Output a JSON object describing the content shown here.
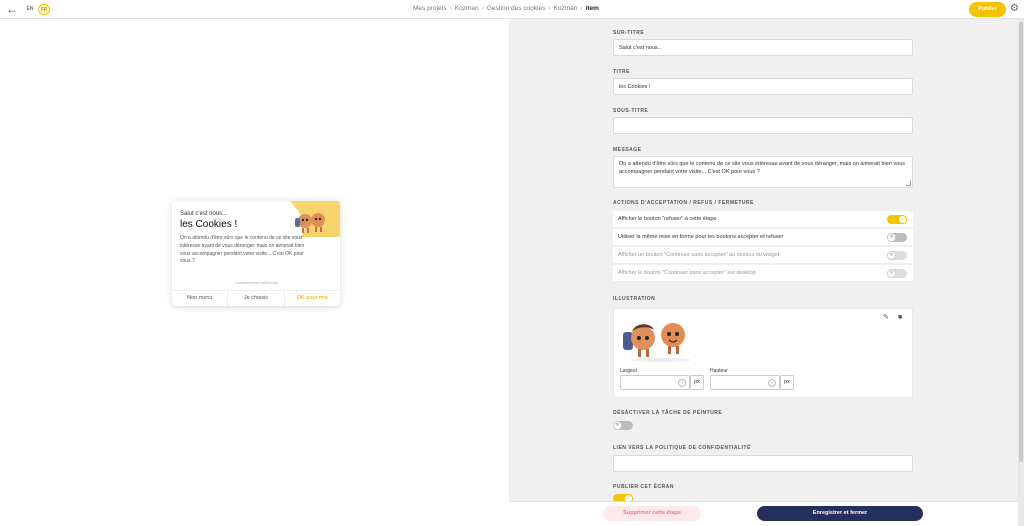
{
  "header": {
    "back_icon": "arrow-left-icon",
    "languages": [
      "EN",
      "FR"
    ],
    "breadcrumb": [
      "Mes projets",
      "Kozman",
      "Gestion des cookies",
      "Kozman",
      "item"
    ],
    "publish_label": "Publier",
    "settings_icon": "gear-icon",
    "accent_color": "#f5c400"
  },
  "preview": {
    "surtitle": "Salut c'est nous...",
    "title": "les Cookies !",
    "message": "On a attendu d'être sûrs que le contenu de ce site vous intéresse avant de vous déranger, mais on aimerait bien vous accompagner pendant votre visite... C'est OK pour vous ?",
    "certification": "Consentements certifiés par",
    "actions": [
      "Non merci",
      "Je choisis",
      "OK pour moi"
    ]
  },
  "form": {
    "surtitle": {
      "label": "SUR-TITRE",
      "value": "Salut c'est nous..."
    },
    "title": {
      "label": "TITRE",
      "value": "les Cookies !"
    },
    "subtitle": {
      "label": "SOUS-TITRE",
      "value": ""
    },
    "message": {
      "label": "MESSAGE",
      "value": "On a attendu d'être sûrs que le contenu de ce site vous intéresse avant de vous déranger, mais on aimerait bien vous accompagner pendant votre visite... C'est OK pour vous ?"
    },
    "actions": {
      "label": "ACTIONS D'ACCEPTATION / REFUS / FERMETURE",
      "options": [
        {
          "label": "Afficher le bouton \"refuser\" à cette étape",
          "on": true
        },
        {
          "label": "Utiliser la même mise en forme pour les boutons accepter et refuser",
          "on": false
        },
        {
          "label": "Afficher un bouton \"Continuer sans accepter\" au dessus du widget",
          "on": false
        },
        {
          "label": "Afficher le bouton \"Continuer sans accepter\" sur desktop",
          "on": false
        }
      ]
    },
    "illustration": {
      "label": "ILLUSTRATION",
      "width_label": "Largeur",
      "height_label": "Hauteur",
      "width_value": "",
      "height_value": "",
      "unit": "px"
    },
    "disable_paint": {
      "label": "DÉSACTIVER LA TÂCHE DE PEINTURE",
      "on": false
    },
    "privacy_link": {
      "label": "LIEN VERS LA POLITIQUE DE CONFIDENTIALITÉ",
      "value": ""
    },
    "publish_screen": {
      "label": "PUBLIER CET ÉCRAN",
      "on": true
    }
  },
  "footer": {
    "delete_label": "Supprimer cette étape",
    "save_label": "Enregistrer et fermer"
  }
}
